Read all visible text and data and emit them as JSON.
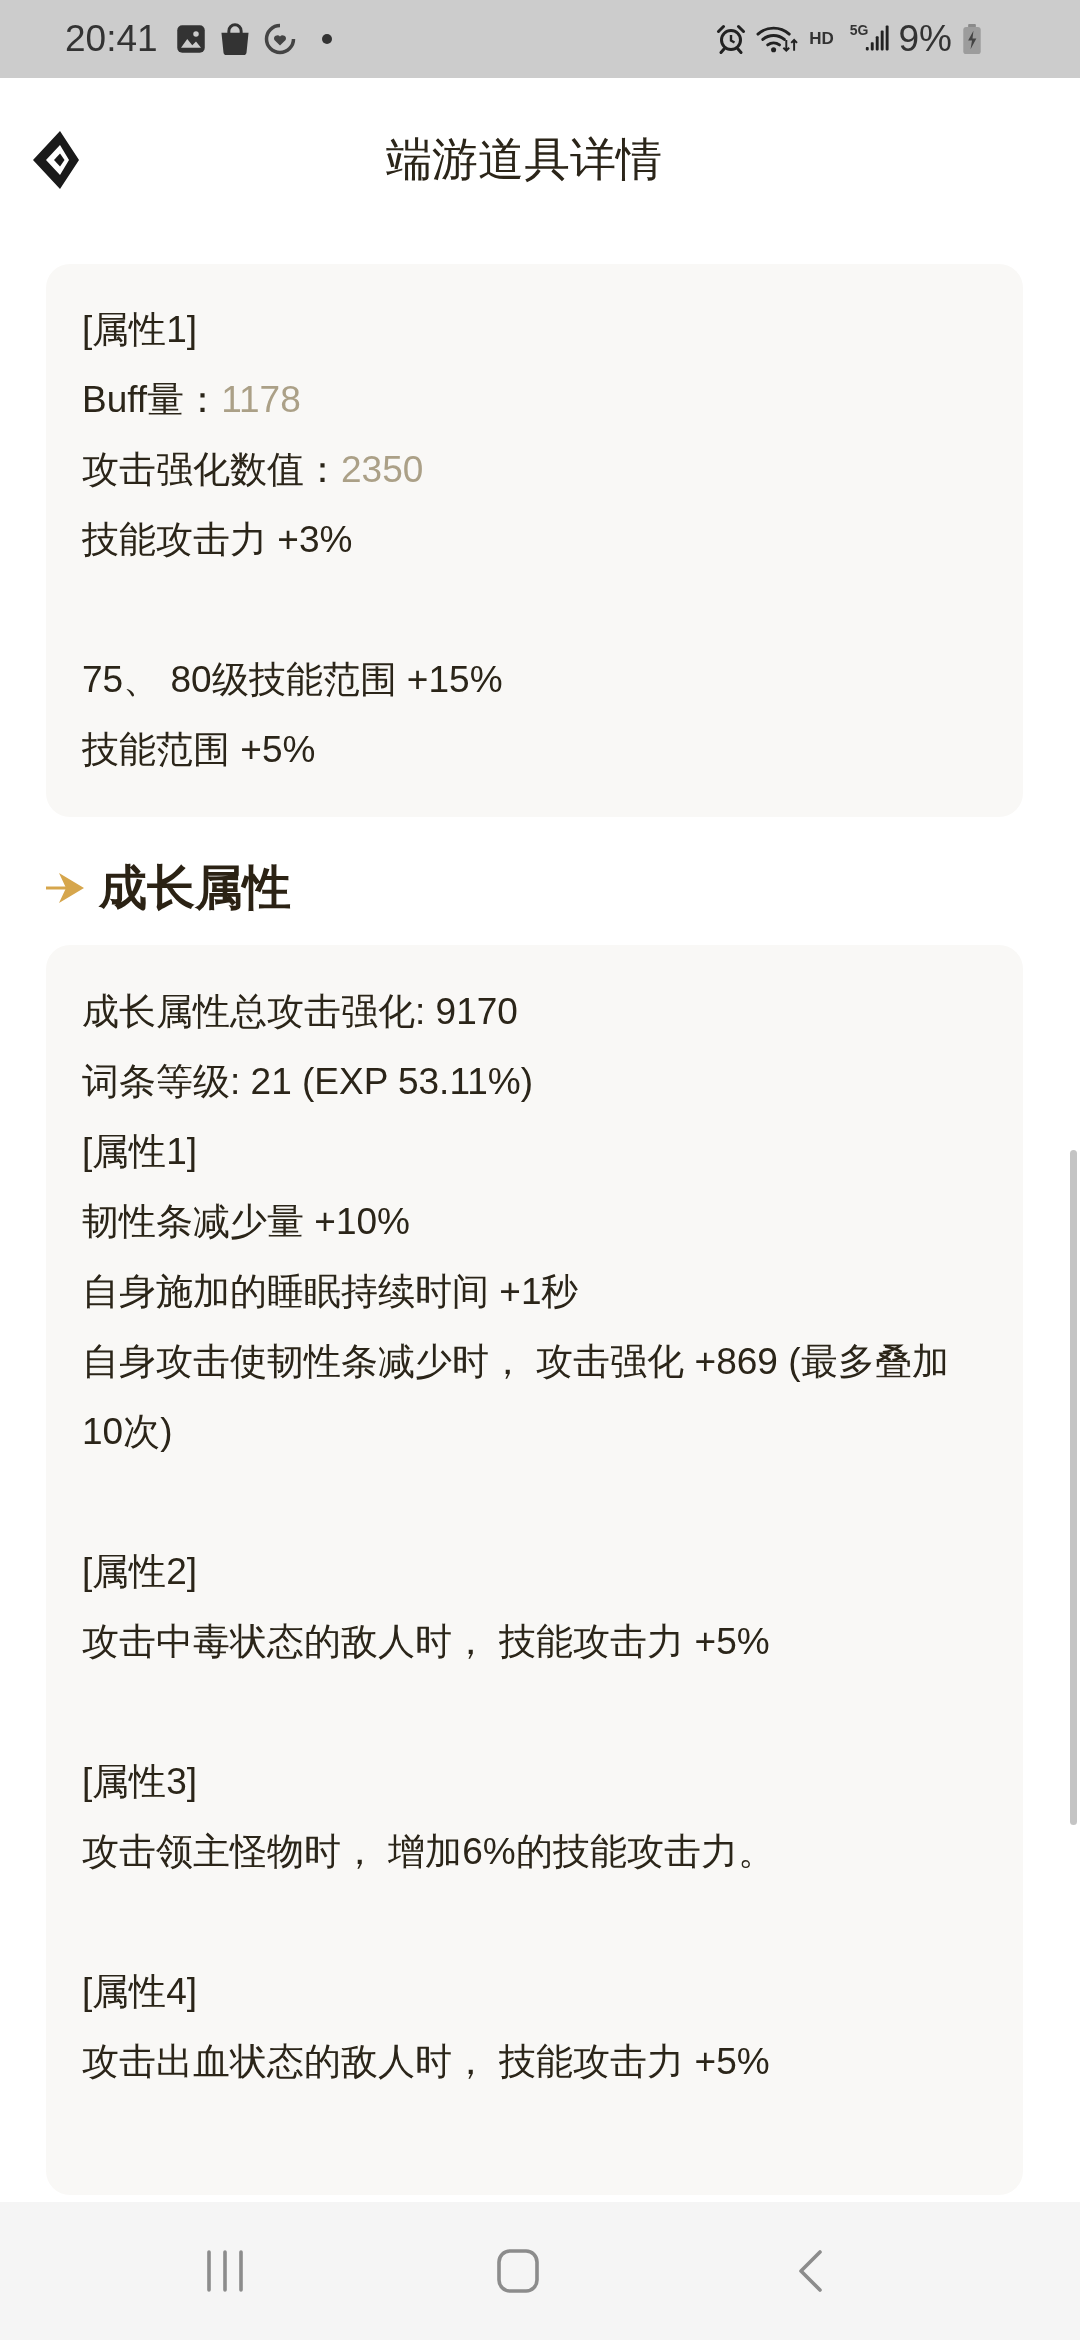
{
  "status_bar": {
    "time": "20:41",
    "hd_label": "HD",
    "network_type": "5G",
    "battery_percent": "9%"
  },
  "header": {
    "title": "端游道具详情"
  },
  "base_card": {
    "blocks": [
      {
        "lines": [
          {
            "kind": "text",
            "text": "[属性1]"
          },
          {
            "kind": "stat",
            "label": "Buff量：",
            "value": "1178"
          },
          {
            "kind": "stat",
            "label": "攻击强化数值：",
            "value": "2350"
          },
          {
            "kind": "text",
            "text": "技能攻击力 +3%"
          }
        ]
      },
      {
        "lines": [
          {
            "kind": "text",
            "text": "75、 80级技能范围 +15%"
          },
          {
            "kind": "text",
            "text": "技能范围 +5%"
          }
        ]
      }
    ]
  },
  "growth_section": {
    "title": "成长属性",
    "blocks": [
      {
        "lines": [
          {
            "kind": "text",
            "text": "成长属性总攻击强化: 9170"
          },
          {
            "kind": "text",
            "text": "词条等级: 21 (EXP 53.11%)"
          },
          {
            "kind": "text",
            "text": "[属性1]"
          },
          {
            "kind": "text",
            "text": "韧性条减少量 +10%"
          },
          {
            "kind": "text",
            "text": "自身施加的睡眠持续时间 +1秒"
          },
          {
            "kind": "text",
            "text": "自身攻击使韧性条减少时， 攻击强化 +869 (最多叠加10次)"
          }
        ]
      },
      {
        "lines": [
          {
            "kind": "text",
            "text": "[属性2]"
          },
          {
            "kind": "text",
            "text": "攻击中毒状态的敌人时， 技能攻击力 +5%"
          }
        ]
      },
      {
        "lines": [
          {
            "kind": "text",
            "text": "[属性3]"
          },
          {
            "kind": "text",
            "text": "攻击领主怪物时， 增加6%的技能攻击力。"
          }
        ]
      },
      {
        "lines": [
          {
            "kind": "text",
            "text": "[属性4]"
          },
          {
            "kind": "text",
            "text": "攻击出血状态的敌人时， 技能攻击力 +5%"
          }
        ]
      }
    ]
  }
}
